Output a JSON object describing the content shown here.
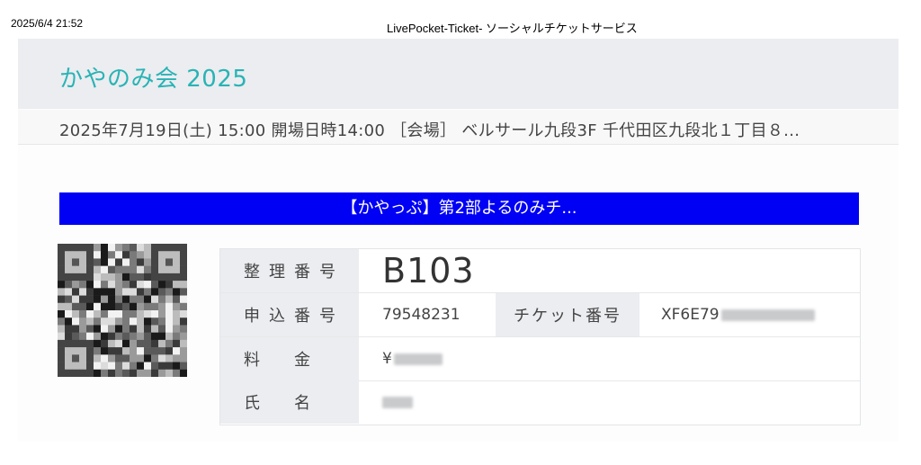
{
  "print_header": {
    "date": "2025/6/4 21:52",
    "title": "LivePocket-Ticket- ソーシャルチケットサービス"
  },
  "event": {
    "title": "かやのみ会 2025",
    "info": "2025年7月19日(土) 15:00 開場日時14:00 ［会場］ ベルサール九段3F 千代田区九段北１丁目８..."
  },
  "ticket_type": "【かやっぷ】第2部よるのみチ...",
  "qr": {
    "icon": "qr-code-icon"
  },
  "details": {
    "seat_label": "整理番号",
    "seat_value": "B103",
    "application_label": "申込番号",
    "application_value": "79548231",
    "ticket_no_label": "チケット番号",
    "ticket_no_visible": "XF6E79",
    "fee_label": "料金",
    "fee_prefix": "¥",
    "name_label": "氏名"
  }
}
